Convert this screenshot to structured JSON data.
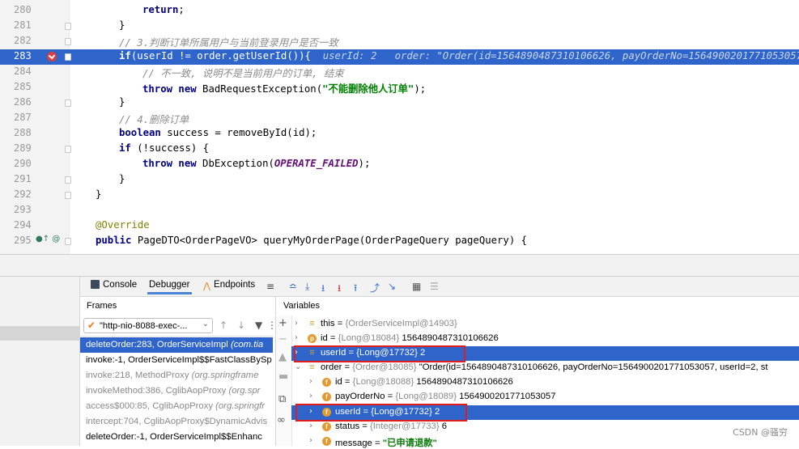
{
  "editor": {
    "lines": [
      {
        "num": "280",
        "parts": [
          {
            "cls": "kw",
            "t": "return"
          },
          {
            "cls": "",
            "t": ";"
          }
        ]
      },
      {
        "num": "281",
        "parts": [
          {
            "cls": "",
            "t": "}"
          }
        ]
      },
      {
        "num": "282",
        "parts": [
          {
            "cls": "cmt",
            "t": "// 3.判断订单所属用户与当前登录用户是否一致"
          }
        ]
      },
      {
        "num": "283",
        "current": true,
        "parts": [
          {
            "cls": "kw",
            "t": "if"
          },
          {
            "cls": "",
            "t": "(userId "
          },
          {
            "cls": "",
            "t": "!="
          },
          {
            "cls": "",
            "t": " order.getUserId()){"
          },
          {
            "cls": "inline-hint",
            "t": "  userId: 2   order: \"Order(id=1564890487310106626, payOrderNo=1564900201771053057"
          }
        ]
      },
      {
        "num": "284",
        "parts": [
          {
            "cls": "cmt",
            "t": "// 不一致, 说明不是当前用户的订单, 结束"
          }
        ]
      },
      {
        "num": "285",
        "parts": [
          {
            "cls": "kw",
            "t": "throw new "
          },
          {
            "cls": "",
            "t": "BadRequestException("
          },
          {
            "cls": "str",
            "t": "\"不能删除他人订单\""
          },
          {
            "cls": "",
            "t": ");"
          }
        ]
      },
      {
        "num": "286",
        "parts": [
          {
            "cls": "",
            "t": "}"
          }
        ]
      },
      {
        "num": "287",
        "parts": [
          {
            "cls": "cmt",
            "t": "// 4.删除订单"
          }
        ]
      },
      {
        "num": "288",
        "parts": [
          {
            "cls": "kw",
            "t": "boolean "
          },
          {
            "cls": "",
            "t": "success = removeById(id);"
          }
        ]
      },
      {
        "num": "289",
        "parts": [
          {
            "cls": "kw",
            "t": "if "
          },
          {
            "cls": "",
            "t": "(!success) {"
          }
        ]
      },
      {
        "num": "290",
        "parts": [
          {
            "cls": "kw",
            "t": "throw new "
          },
          {
            "cls": "",
            "t": "DbException("
          },
          {
            "cls": "const",
            "t": "OPERATE_FAILED"
          },
          {
            "cls": "",
            "t": ");"
          }
        ]
      },
      {
        "num": "291",
        "parts": [
          {
            "cls": "",
            "t": "}"
          }
        ]
      },
      {
        "num": "292",
        "parts": [
          {
            "cls": "",
            "t": "}"
          }
        ]
      },
      {
        "num": "293",
        "parts": []
      },
      {
        "num": "294",
        "parts": [
          {
            "cls": "ann",
            "t": "@Override"
          }
        ]
      },
      {
        "num": "295",
        "parts": [
          {
            "cls": "kw",
            "t": "public "
          },
          {
            "cls": "",
            "t": "PageDTO<OrderPageVO> queryMyOrderPage(OrderPageQuery pageQuery) {"
          }
        ]
      }
    ]
  },
  "tabs": {
    "console": "Console",
    "debugger": "Debugger",
    "endpoints": "Endpoints"
  },
  "frames": {
    "header": "Frames",
    "thread": "\"http-nio-8088-exec-...",
    "items": [
      {
        "method": "deleteOrder:283, OrderServiceImpl ",
        "pkg": "(com.tia",
        "selected": true,
        "dim": false
      },
      {
        "method": "invoke:-1, OrderServiceImpl$$FastClassBySp",
        "pkg": "",
        "selected": false,
        "dim": false
      },
      {
        "method": "invoke:218, MethodProxy ",
        "pkg": "(org.springframe",
        "selected": false,
        "dim": true
      },
      {
        "method": "invokeMethod:386, CglibAopProxy ",
        "pkg": "(org.spr",
        "selected": false,
        "dim": true
      },
      {
        "method": "access$000:85, CglibAopProxy ",
        "pkg": "(org.springfr",
        "selected": false,
        "dim": true
      },
      {
        "method": "intercept:704, CglibAopProxy$DynamicAdvis",
        "pkg": "",
        "selected": false,
        "dim": true
      },
      {
        "method": "deleteOrder:-1, OrderServiceImpl$$Enhanc",
        "pkg": "",
        "selected": false,
        "dim": false
      }
    ]
  },
  "variables": {
    "header": "Variables",
    "items": [
      {
        "arrow": "›",
        "icon": "eq",
        "name": "this = ",
        "gray": "{OrderServiceImpl@14903}",
        "value": "",
        "indent": 0
      },
      {
        "arrow": "›",
        "icon": "p",
        "name": "id = ",
        "gray": "{Long@18084} ",
        "value": "1564890487310106626",
        "indent": 0
      },
      {
        "arrow": "›",
        "icon": "eq",
        "name": "userId = ",
        "gray": "{Long@17732} ",
        "value": "2",
        "indent": 0,
        "selected": true
      },
      {
        "arrow": "⌄",
        "icon": "eq",
        "name": "order = ",
        "gray": "{Order@18085} ",
        "value": "\"Order(id=1564890487310106626, payOrderNo=1564900201771053057, userId=2, st",
        "indent": 0
      },
      {
        "arrow": "›",
        "icon": "f",
        "name": "id = ",
        "gray": "{Long@18088} ",
        "value": "1564890487310106626",
        "indent": 1
      },
      {
        "arrow": "›",
        "icon": "f",
        "name": "payOrderNo = ",
        "gray": "{Long@18089} ",
        "value": "1564900201771053057",
        "indent": 1
      },
      {
        "arrow": "›",
        "icon": "f",
        "name": "userId = ",
        "gray": "{Long@17732} ",
        "value": "2",
        "indent": 1,
        "selected": true
      },
      {
        "arrow": "›",
        "icon": "f",
        "name": "status = ",
        "gray": "{Integer@17733} ",
        "value": "6",
        "indent": 1
      },
      {
        "arrow": "›",
        "icon": "f",
        "name": "message = ",
        "gray": "",
        "value": "\"已申请退款\"",
        "indent": 1,
        "str": true
      }
    ]
  },
  "watermark": "CSDN @骚穷"
}
